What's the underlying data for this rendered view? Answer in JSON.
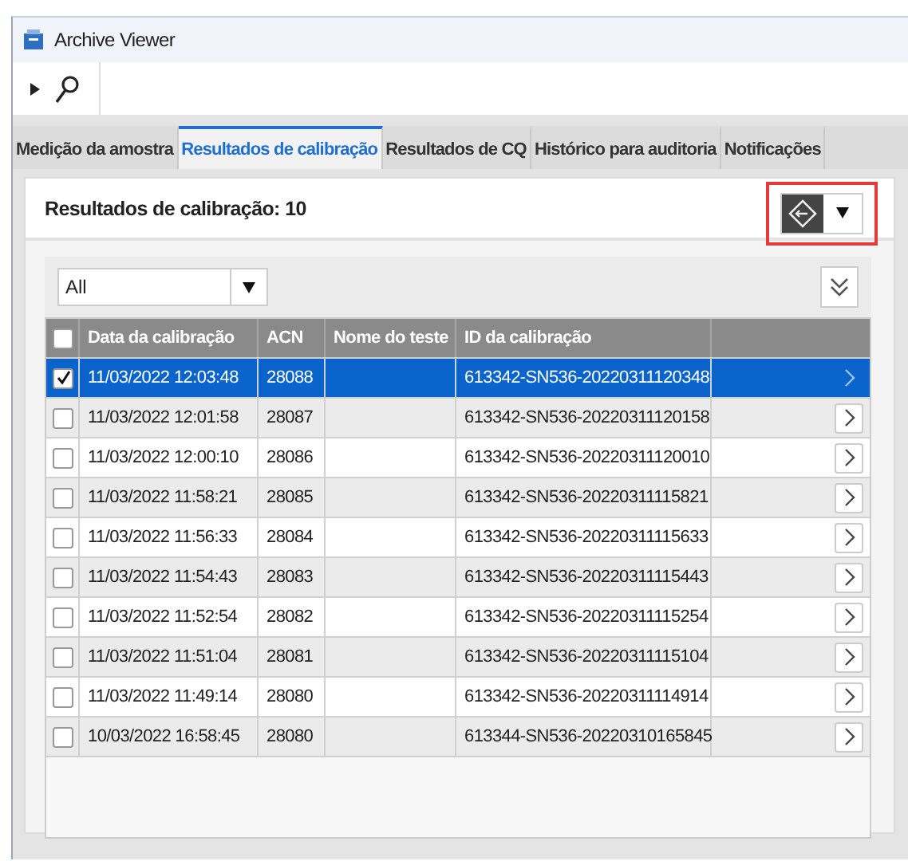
{
  "window": {
    "title": "Archive Viewer"
  },
  "tabs": [
    {
      "label": "Medição da amostra",
      "selected": false
    },
    {
      "label": "Resultados de calibração",
      "selected": true
    },
    {
      "label": "Resultados de CQ",
      "selected": false
    },
    {
      "label": "Histórico para auditoria",
      "selected": false
    },
    {
      "label": "Notificações",
      "selected": false
    }
  ],
  "panel": {
    "title": "Resultados de calibração: 10"
  },
  "filter": {
    "value": "All"
  },
  "table": {
    "columns": [
      "Data da calibração",
      "ACN",
      "Nome do teste",
      "ID da calibração"
    ],
    "all_checked": false,
    "rows": [
      {
        "date": "11/03/2022 12:03:48",
        "acn": "28088",
        "test": "",
        "id": "613342-SN536-20220311120348",
        "checked": true,
        "selected": true
      },
      {
        "date": "11/03/2022 12:01:58",
        "acn": "28087",
        "test": "",
        "id": "613342-SN536-20220311120158",
        "checked": false,
        "selected": false
      },
      {
        "date": "11/03/2022 12:00:10",
        "acn": "28086",
        "test": "",
        "id": "613342-SN536-20220311120010",
        "checked": false,
        "selected": false
      },
      {
        "date": "11/03/2022 11:58:21",
        "acn": "28085",
        "test": "",
        "id": "613342-SN536-20220311115821",
        "checked": false,
        "selected": false
      },
      {
        "date": "11/03/2022 11:56:33",
        "acn": "28084",
        "test": "",
        "id": "613342-SN536-20220311115633",
        "checked": false,
        "selected": false
      },
      {
        "date": "11/03/2022 11:54:43",
        "acn": "28083",
        "test": "",
        "id": "613342-SN536-20220311115443",
        "checked": false,
        "selected": false
      },
      {
        "date": "11/03/2022 11:52:54",
        "acn": "28082",
        "test": "",
        "id": "613342-SN536-20220311115254",
        "checked": false,
        "selected": false
      },
      {
        "date": "11/03/2022 11:51:04",
        "acn": "28081",
        "test": "",
        "id": "613342-SN536-20220311115104",
        "checked": false,
        "selected": false
      },
      {
        "date": "11/03/2022 11:49:14",
        "acn": "28080",
        "test": "",
        "id": "613342-SN536-20220311114914",
        "checked": false,
        "selected": false
      },
      {
        "date": "10/03/2022 16:58:45",
        "acn": "28080",
        "test": "",
        "id": "613344-SN536-20220310165845",
        "checked": false,
        "selected": false
      }
    ]
  }
}
